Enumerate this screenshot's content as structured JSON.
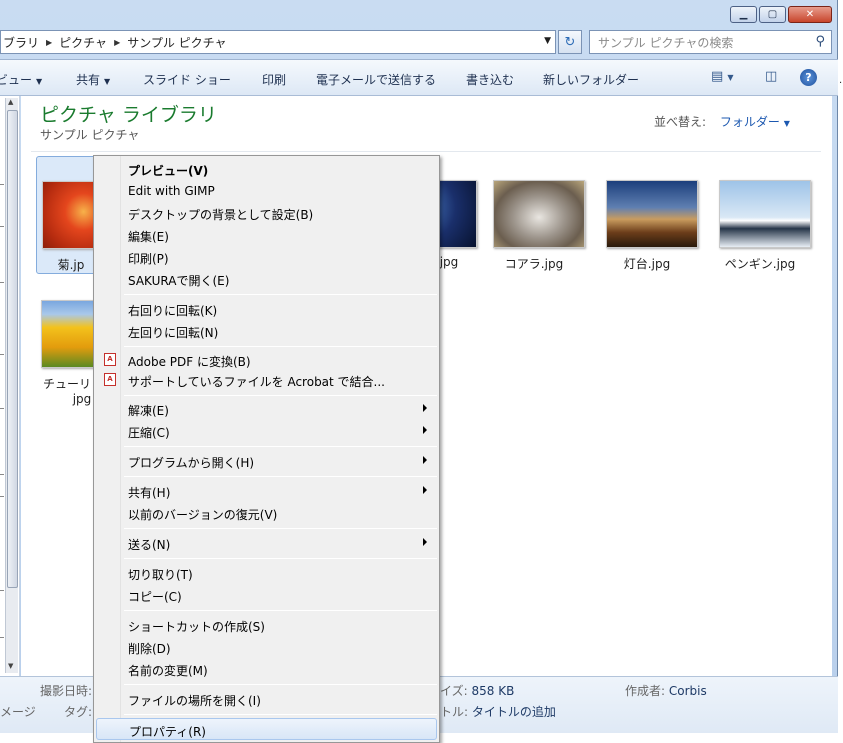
{
  "address": {
    "crumbs": [
      "ブラリ",
      "ピクチャ",
      "サンプル ピクチャ"
    ],
    "search_placeholder": "サンプル ピクチャの検索"
  },
  "toolbar": {
    "view_label": "ビュー",
    "share_label": "共有",
    "slideshow_label": "スライド ショー",
    "print_label": "印刷",
    "email_label": "電子メールで送信する",
    "burn_label": "書き込む",
    "new_folder_label": "新しいフォルダー"
  },
  "outside_mark": ".",
  "library": {
    "title": "ピクチャ ライブラリ",
    "subtitle": "サンプル ピクチャ",
    "sort_label": "並べ替え:",
    "sort_value": "フォルダー"
  },
  "files": [
    {
      "label": "菊.jpg",
      "icon": "chrysanthemum-image"
    },
    {
      "label": "クラゲ.jpg",
      "icon": "jellyfish-image"
    },
    {
      "label": "コアラ.jpg",
      "icon": "koala-image"
    },
    {
      "label": "灯台.jpg",
      "icon": "lighthouse-image"
    },
    {
      "label": "ペンギン.jpg",
      "icon": "penguins-image"
    },
    {
      "label": "チューリップ.jpg",
      "icon": "tulips-image"
    }
  ],
  "visible_label_fragments": {
    "file0": "菊.jp",
    "file1": "jpg",
    "file5_line1": "チューリ",
    "file5_line2": "jpg"
  },
  "details": {
    "date_taken_label": "撮影日時:",
    "tags_label": "タグ:",
    "left_fragment": "メージ",
    "size_label": "イズ:",
    "size_value": "858 KB",
    "title_label": "トル:",
    "title_value": "タイトルの追加",
    "author_label": "作成者:",
    "author_value": "Corbis"
  },
  "context_menu": {
    "items": [
      {
        "label": "プレビュー(V)",
        "bold": true
      },
      {
        "label": "Edit with GIMP"
      },
      {
        "label": "デスクトップの背景として設定(B)"
      },
      {
        "label": "編集(E)"
      },
      {
        "label": "印刷(P)"
      },
      {
        "label": "SAKURAで開く(E)"
      },
      {
        "label": "右回りに回転(K)"
      },
      {
        "label": "左回りに回転(N)"
      },
      {
        "label": "Adobe PDF に変換(B)",
        "icon": "adobe-pdf-icon"
      },
      {
        "label": "サポートしているファイルを Acrobat で結合...",
        "icon": "adobe-pdf-icon"
      },
      {
        "label": "解凍(E)",
        "submenu": true
      },
      {
        "label": "圧縮(C)",
        "submenu": true
      },
      {
        "label": "プログラムから開く(H)",
        "submenu": true
      },
      {
        "label": "共有(H)",
        "submenu": true
      },
      {
        "label": "以前のバージョンの復元(V)"
      },
      {
        "label": "送る(N)",
        "submenu": true
      },
      {
        "label": "切り取り(T)"
      },
      {
        "label": "コピー(C)"
      },
      {
        "label": "ショートカットの作成(S)"
      },
      {
        "label": "削除(D)"
      },
      {
        "label": "名前の変更(M)"
      },
      {
        "label": "ファイルの場所を開く(I)"
      },
      {
        "label": "プロパティ(R)",
        "highlighted": true
      }
    ]
  }
}
